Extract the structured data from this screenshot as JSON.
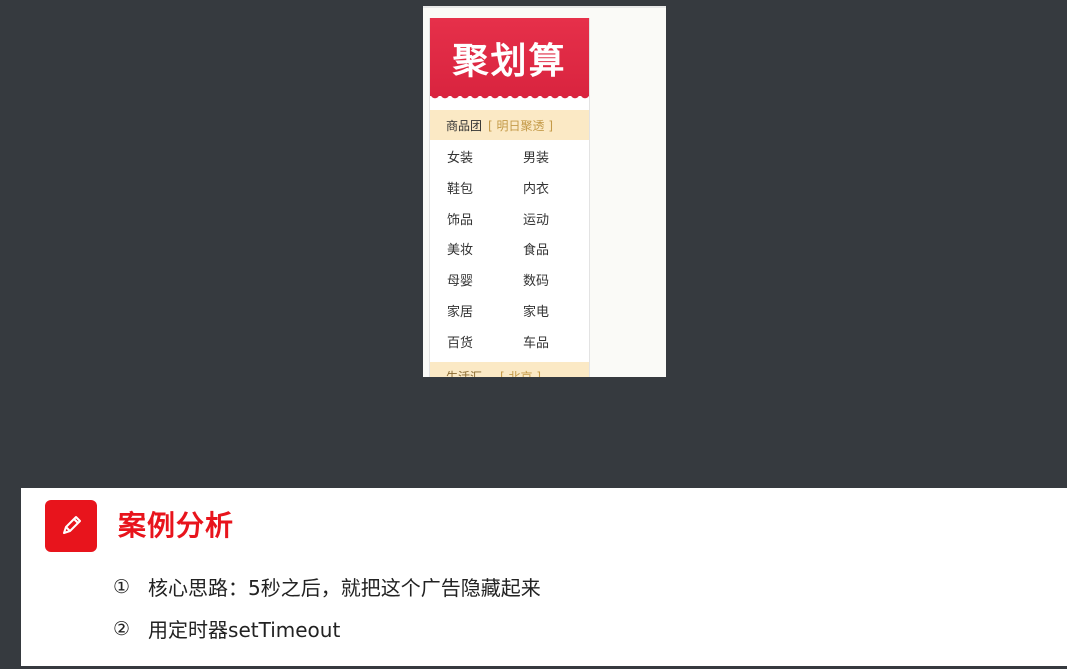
{
  "ad": {
    "title": "聚划算",
    "section1": {
      "label": "商品团",
      "bracket": "[ 明日聚透 ]"
    },
    "categories": [
      "女装",
      "男装",
      "鞋包",
      "内衣",
      "饰品",
      "运动",
      "美妆",
      "食品",
      "母婴",
      "数码",
      "家居",
      "家电",
      "百货",
      "车品"
    ],
    "section2": {
      "label": "生活汇",
      "bracket": "[ 北京 ]"
    }
  },
  "panel": {
    "icon": "pencil-icon",
    "accent": "#e8141c",
    "title": "案例分析",
    "points": [
      {
        "num": "①",
        "text": "核心思路：5秒之后，就把这个广告隐藏起来"
      },
      {
        "num": "②",
        "text": "用定时器setTimeout"
      }
    ]
  }
}
